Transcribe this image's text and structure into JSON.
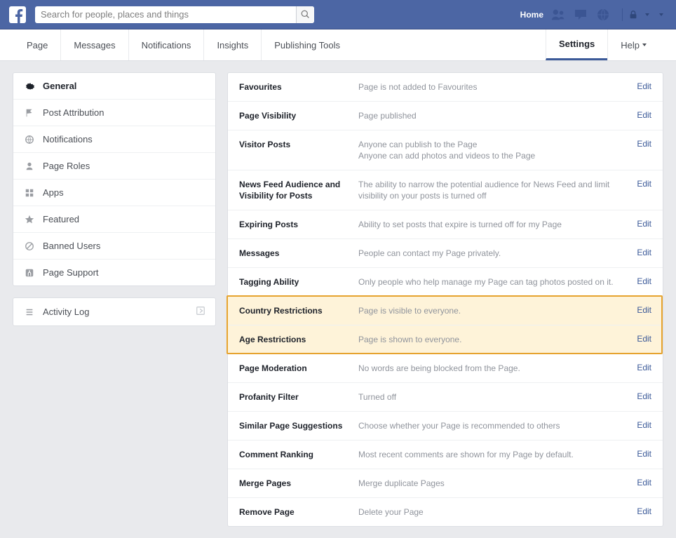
{
  "search": {
    "placeholder": "Search for people, places and things"
  },
  "topbar": {
    "home": "Home"
  },
  "nav": {
    "page": "Page",
    "messages": "Messages",
    "notifications": "Notifications",
    "insights": "Insights",
    "publishing": "Publishing Tools",
    "settings": "Settings",
    "help": "Help"
  },
  "sidebar": {
    "general": "General",
    "post_attribution": "Post Attribution",
    "notifications": "Notifications",
    "page_roles": "Page Roles",
    "apps": "Apps",
    "featured": "Featured",
    "banned_users": "Banned Users",
    "page_support": "Page Support",
    "activity_log": "Activity Log"
  },
  "settings": [
    {
      "key": "favourites",
      "label": "Favourites",
      "desc": "Page is not added to Favourites",
      "edit": "Edit",
      "hl": false
    },
    {
      "key": "page_visibility",
      "label": "Page Visibility",
      "desc": "Page published",
      "edit": "Edit",
      "hl": false
    },
    {
      "key": "visitor_posts",
      "label": "Visitor Posts",
      "desc": "Anyone can publish to the Page\nAnyone can add photos and videos to the Page",
      "edit": "Edit",
      "hl": false
    },
    {
      "key": "news_feed",
      "label": "News Feed Audience and Visibility for Posts",
      "desc": "The ability to narrow the potential audience for News Feed and limit visibility on your posts is turned off",
      "edit": "Edit",
      "hl": false
    },
    {
      "key": "expiring_posts",
      "label": "Expiring Posts",
      "desc": "Ability to set posts that expire is turned off for my Page",
      "edit": "Edit",
      "hl": false
    },
    {
      "key": "messages_row",
      "label": "Messages",
      "desc": "People can contact my Page privately.",
      "edit": "Edit",
      "hl": false
    },
    {
      "key": "tagging",
      "label": "Tagging Ability",
      "desc": "Only people who help manage my Page can tag photos posted on it.",
      "edit": "Edit",
      "hl": false
    },
    {
      "key": "country",
      "label": "Country Restrictions",
      "desc": "Page is visible to everyone.",
      "edit": "Edit",
      "hl": true
    },
    {
      "key": "age",
      "label": "Age Restrictions",
      "desc": "Page is shown to everyone.",
      "edit": "Edit",
      "hl": true
    },
    {
      "key": "moderation",
      "label": "Page Moderation",
      "desc": "No words are being blocked from the Page.",
      "edit": "Edit",
      "hl": false
    },
    {
      "key": "profanity",
      "label": "Profanity Filter",
      "desc": "Turned off",
      "edit": "Edit",
      "hl": false
    },
    {
      "key": "similar",
      "label": "Similar Page Suggestions",
      "desc": "Choose whether your Page is recommended to others",
      "edit": "Edit",
      "hl": false
    },
    {
      "key": "ranking",
      "label": "Comment Ranking",
      "desc": "Most recent comments are shown for my Page by default.",
      "edit": "Edit",
      "hl": false
    },
    {
      "key": "merge",
      "label": "Merge Pages",
      "desc": "Merge duplicate Pages",
      "edit": "Edit",
      "hl": false
    },
    {
      "key": "remove",
      "label": "Remove Page",
      "desc": "Delete your Page",
      "edit": "Edit",
      "hl": false
    }
  ]
}
